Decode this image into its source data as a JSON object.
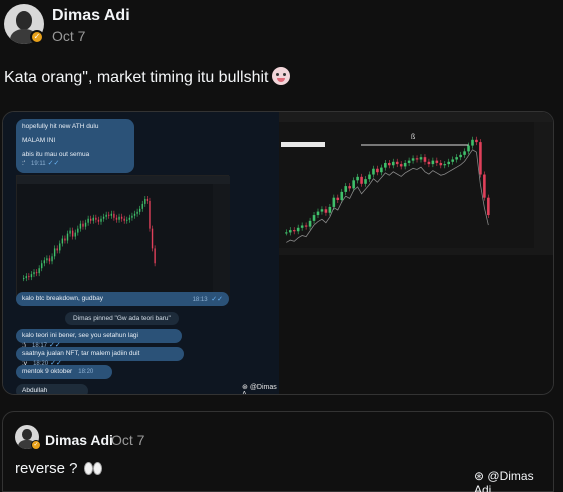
{
  "post": {
    "author": "Dimas Adi",
    "date": "Oct 7",
    "text": "Kata orang\", market timing itu bullshit"
  },
  "chat": {
    "msg1_line1": "hopefully hit new ATH dulu",
    "msg1_line2": "MALAM INI",
    "msg1_line3": "abis itu mau out semua :'",
    "msg1_time": "19:11",
    "msg2": "kalo btc breakdown, gudbay",
    "msg2_time": "18:13",
    "pinned": "Dimas pinned \"Gw ada teori baru\"",
    "msg3": "kalo teori ini bener, see you setahun lagi :)",
    "msg3_time": "18:17",
    "msg4": "saatnya jualan NFT, tar malem jadiin duit :v",
    "msg4_time": "18:20",
    "msg5": "mentok 9 oktober",
    "msg5_time": "18:20",
    "msg6": "Abdullah",
    "watermark": "@Dimas A"
  },
  "quote": {
    "author": "Dimas Adi",
    "date": "Oct 7",
    "text": "reverse ?",
    "watermark": "@Dimas Adi"
  },
  "chart_data": {
    "type": "line",
    "values": [
      40,
      42,
      41,
      44,
      46,
      45,
      50,
      55,
      58,
      60,
      57,
      62,
      70,
      68,
      75,
      80,
      78,
      85,
      88,
      82,
      86,
      90,
      95,
      92,
      96,
      100,
      98,
      101,
      99,
      97,
      100,
      102,
      104,
      103,
      105,
      101,
      99,
      102,
      100,
      98,
      99,
      101,
      103,
      105,
      107,
      110,
      115,
      120,
      118,
      90,
      70,
      55
    ],
    "ylim": [
      30,
      125
    ]
  }
}
